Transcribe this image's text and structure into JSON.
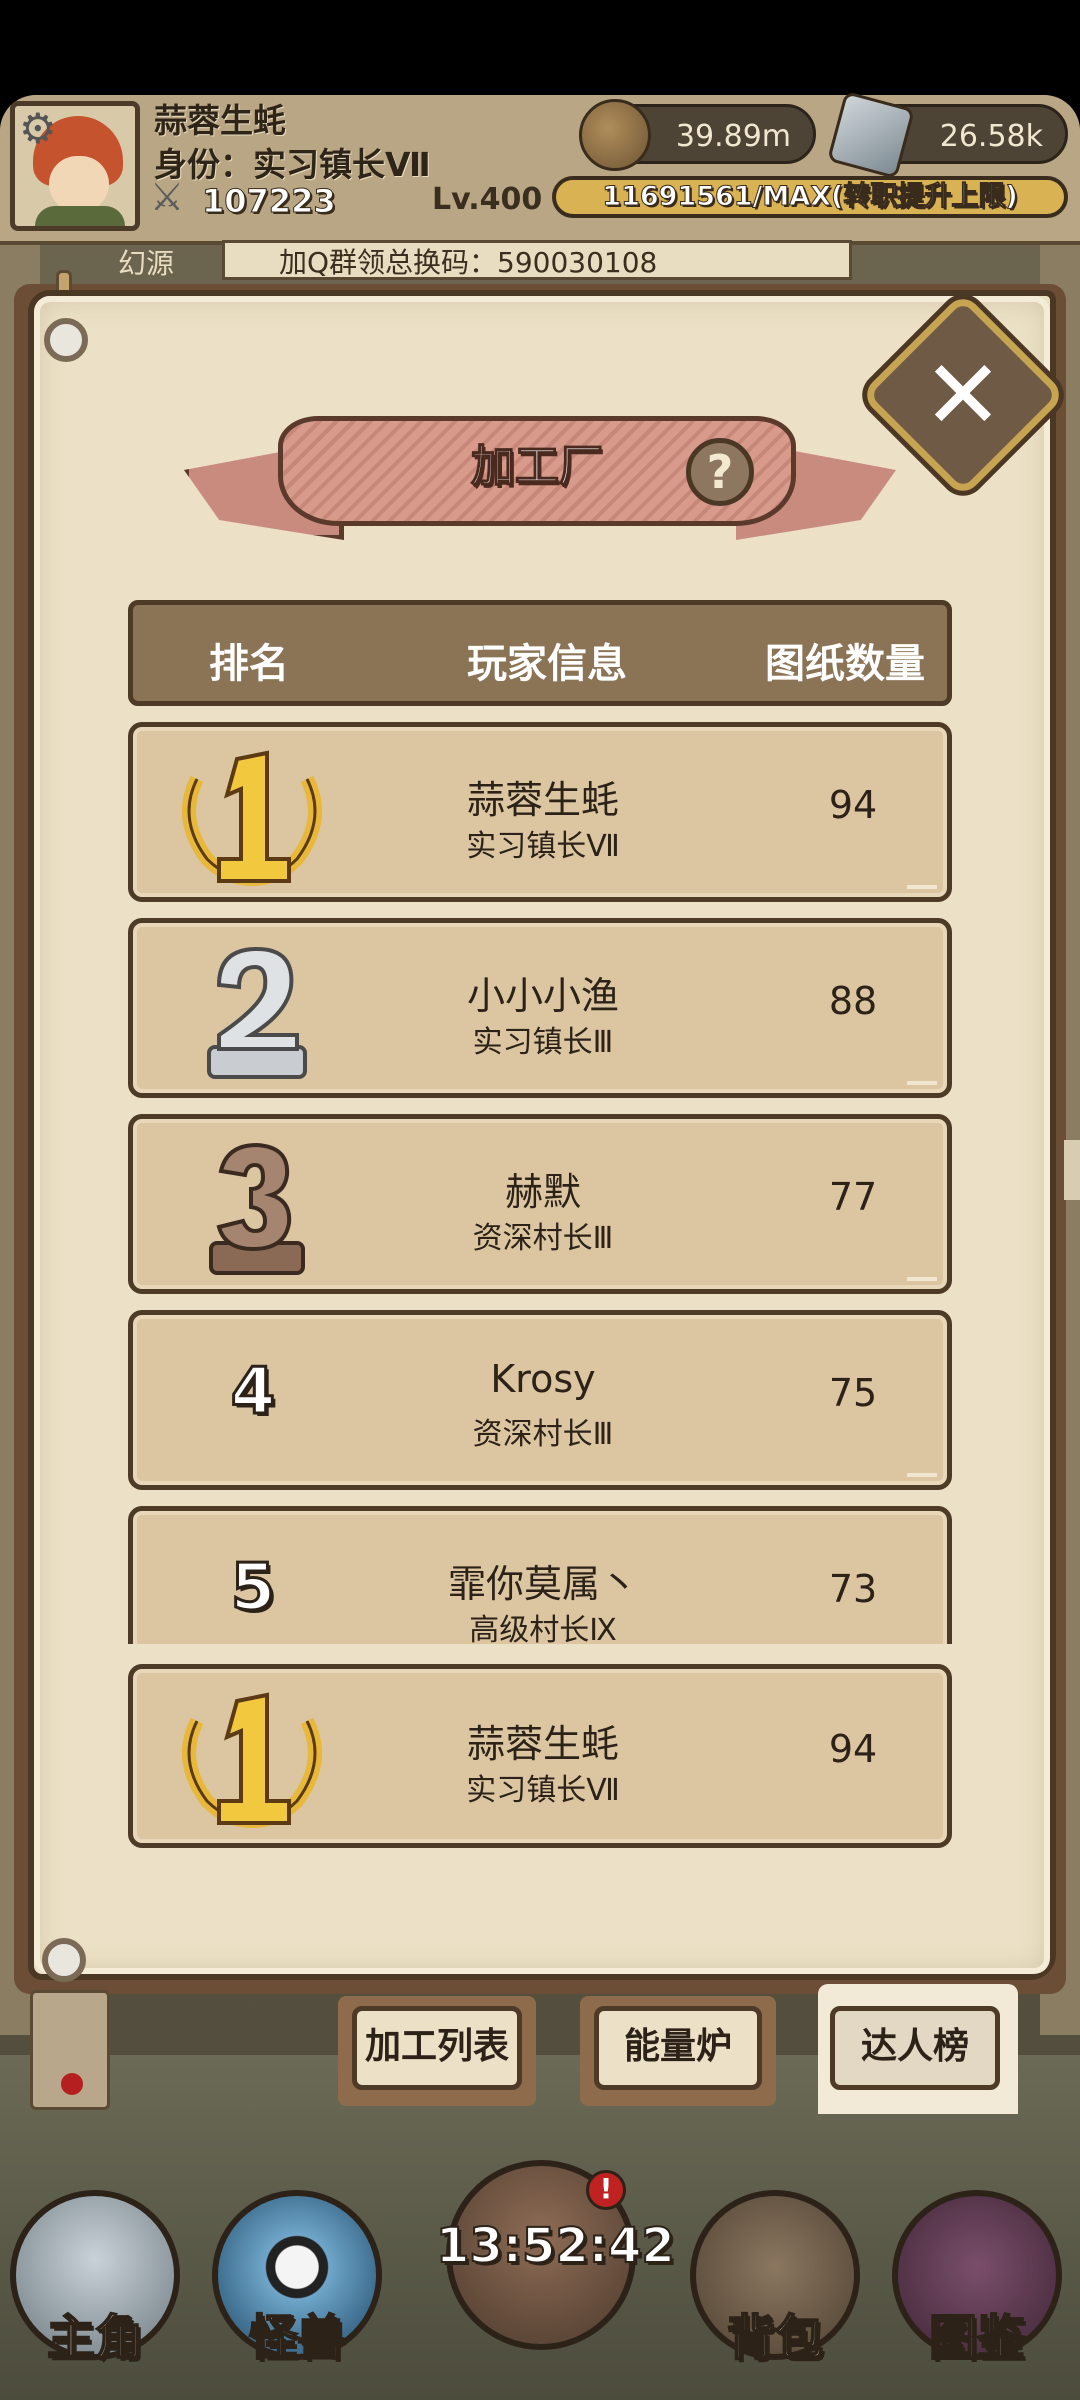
{
  "header": {
    "player_name": "蒜蓉生蚝",
    "player_title": "身份：实习镇长Ⅶ",
    "power": "107223",
    "coins": "39.89m",
    "stones": "26.58k",
    "level": "Lv.400",
    "exp_text": "11691561/MAX(转职提升上限)",
    "behind_tag": "幻源",
    "behind_notice": "加Q群领总换码：590030108"
  },
  "panel": {
    "title": "加工厂",
    "help": "?",
    "close": "✕",
    "columns": {
      "rank": "排名",
      "player": "玩家信息",
      "count": "图纸数量"
    }
  },
  "rows": [
    {
      "rank": "1",
      "name": "蒜蓉生蚝",
      "title": "实习镇长Ⅶ",
      "count": "94"
    },
    {
      "rank": "2",
      "name": "小小小渔",
      "title": "实习镇长Ⅲ",
      "count": "88"
    },
    {
      "rank": "3",
      "name": "赫默",
      "title": "资深村长Ⅲ",
      "count": "77"
    },
    {
      "rank": "4",
      "name": "Krosy",
      "title": "资深村长Ⅲ",
      "count": "75"
    },
    {
      "rank": "5",
      "name": "霏你莫属丶",
      "title": "高级村长Ⅸ",
      "count": "73"
    }
  ],
  "self_row": {
    "rank": "1",
    "name": "蒜蓉生蚝",
    "title": "实习镇长Ⅶ",
    "count": "94"
  },
  "tabs": [
    {
      "label": "加工列表",
      "active": false
    },
    {
      "label": "能量炉",
      "active": false
    },
    {
      "label": "达人榜",
      "active": true
    }
  ],
  "nav": {
    "hero": "主角",
    "monster": "怪兽",
    "bag": "背包",
    "codex": "图鉴",
    "center_badge": "!",
    "clock": "13:52:42"
  },
  "colors": {
    "parchment": "#ece1c6",
    "row_bg": "#dcc6a2",
    "header_bar": "#8b7356",
    "ribbon": "#d79a8b",
    "gold": "#e8b83a",
    "silver": "#c9ccd0",
    "bronze": "#8a6a55"
  },
  "icons": {
    "rank1": "gold-laurel-medal-icon",
    "rank2": "silver-trophy-2-icon",
    "rank3": "bronze-trophy-3-icon"
  }
}
